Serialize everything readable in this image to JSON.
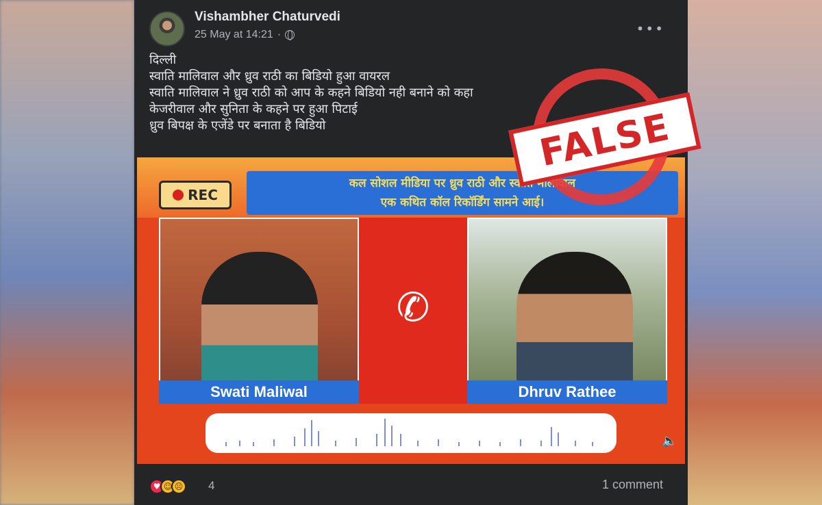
{
  "post": {
    "author": "Vishambher Chaturvedi",
    "timestamp": "25 May at 14:21",
    "separator": "·",
    "more_icon": "more-horizontal-icon",
    "text_lines": [
      "दिल्ली",
      "स्वाति मालिवाल और ध्रुव राठी का बिडियो हुआ वायरल",
      "स्वाति मालिवाल ने ध्रुव राठी को आप के कहने बिडियो नही बनाने को कहा",
      "केजरीवाल और सुनिता के कहने पर हुआ पिटाई",
      "ध्रुव बिपक्ष के एजेंडे पर बनाता है बिडियो"
    ]
  },
  "media": {
    "rec_label": "REC",
    "banner_line1": "कल सोशल मीडिया पर ध्रुव राठी और स्वाति मालीवाल",
    "banner_line2": "एक कथित कॉल रिकॉर्डिंग सामने आई।",
    "left_name": "Swati Maliwal",
    "right_name": "Dhruv Rathee",
    "phone_icon": "phone-icon",
    "volume_icon": "volume-icon"
  },
  "stamp": {
    "label": "FALSE"
  },
  "footer": {
    "reaction_count": "4",
    "comments_label": "1 comment"
  },
  "colors": {
    "post_bg": "#242526",
    "text": "#e4e6eb",
    "muted": "#b0b3b8",
    "stamp_red": "#d42626",
    "banner_blue": "#2a6fd6"
  }
}
